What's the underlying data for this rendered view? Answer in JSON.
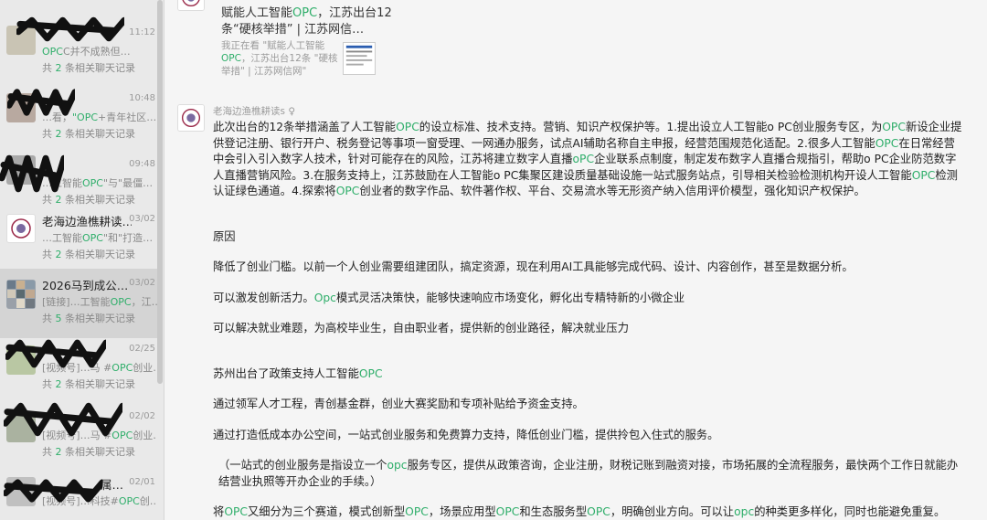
{
  "sidebar": {
    "items": [
      {
        "time": "11:12",
        "preview_pre": "",
        "preview_hl": "OPC",
        "preview_post": "C并不成熟但…",
        "rel_pre": "共 ",
        "rel_count": "2",
        "rel_post": " 条相关聊天记录"
      },
      {
        "time": "10:48",
        "preview_pre": "…看，",
        "preview_hl": "\"OPC",
        "preview_post": "+青年社区…",
        "rel_pre": "共 ",
        "rel_count": "2",
        "rel_post": " 条相关聊天记录"
      },
      {
        "time": "09:48",
        "preview_pre": "…工智能",
        "preview_hl": "OPC",
        "preview_post": "\"与\"最僵…",
        "rel_pre": "共 ",
        "rel_count": "2",
        "rel_post": " 条相关聊天记录"
      },
      {
        "name": "老海边渔樵耕读…",
        "time": "03/02",
        "preview_pre": "…工智能",
        "preview_hl": "OPC",
        "preview_post": "\"和\"打造…",
        "rel_pre": "共 ",
        "rel_count": "2",
        "rel_post": " 条相关聊天记录"
      },
      {
        "name": "2026马到成公…",
        "time": "03/02",
        "preview_pre": "[链接]…工智能",
        "preview_hl": "OPC",
        "preview_post": "，江…",
        "rel_pre": "共 ",
        "rel_count": "5",
        "rel_post": " 条相关聊天记录"
      },
      {
        "time": "02/25",
        "preview_pre": "[视频号]…马 #",
        "preview_hl": "OPC",
        "preview_post": "创业…",
        "rel_pre": "共 ",
        "rel_count": "2",
        "rel_post": " 条相关聊天记录"
      },
      {
        "time": "02/02",
        "preview_pre": "[视频号]…马 #",
        "preview_hl": "OPC",
        "preview_post": "创业…",
        "rel_pre": "共 ",
        "rel_count": "2",
        "rel_post": " 条相关聊天记录"
      },
      {
        "name_tail": "属…",
        "time": "02/01",
        "preview_pre": "[视频号]…科技#",
        "preview_hl": "OPC",
        "preview_post": "创…"
      }
    ]
  },
  "link_card": {
    "title_1": "赋能人工智能",
    "title_hl": "OPC",
    "title_2": "，江苏出台12条“硬核举措” | 江苏网信…",
    "desc_1": "我正在看 \"赋能人工智能",
    "desc_hl": "OPC",
    "desc_2": "，江苏出台12条 \"硬核举措\" | 江苏网信网\""
  },
  "message": {
    "sender": "老海边渔樵耕读s",
    "sender_suffix": "♀",
    "p1": [
      {
        "t": "此次出台的12条举措涵盖了人工智能"
      },
      {
        "h": "OPC"
      },
      {
        "t": "的设立标准、技术支持。营销、知识产权保护等。1.提出设立人工智能o PC创业服务专区，为"
      },
      {
        "h": "OPC"
      },
      {
        "t": "新设企业提供登记注册、银行开户、税务登记等事项一窗受理、一网通办服务，试点AI辅助名称自主申报，经营范围规范化适配。2.很多人工智能"
      },
      {
        "h": "OPC"
      },
      {
        "t": "在日常经营中会引入引入数字人技术，针对可能存在的风险，江苏将建立数字人直播"
      },
      {
        "h": "oPC"
      },
      {
        "t": "企业联系点制度，制定发布数字人直播合规指引，帮助o PC企业防范数字人直播营销风险。3.在服务支持上，江苏鼓励在人工智能o PC集聚区建设质量基础设施一站式服务站点，引导相关检验检测机构开设人工智能"
      },
      {
        "h": "OPC"
      },
      {
        "t": "检测认证绿色通道。4.探索将"
      },
      {
        "h": "OPC"
      },
      {
        "t": "创业者的数字作品、软件著作权、平台、交易流水等无形资产纳入信用评价模型，强化知识产权保护。"
      }
    ],
    "reason_title": "原因",
    "reason_1": "降低了创业门槛。以前一个人创业需要组建团队，搞定资源，现在利用AI工具能够完成代码、设计、内容创作，甚至是数据分析。",
    "reason_2": [
      {
        "h": "Opc"
      },
      {
        "t": "模式灵活决策快，能够快速响应市场变化，孵化出专精特新的小微企业"
      }
    ],
    "reason_2_pre": "可以激发创新活力。",
    "reason_3": "可以解决就业难题，为高校毕业生，自由职业者，提供新的创业路径，解决就业压力",
    "suzhou": [
      {
        "t": "苏州出台了政策支持人工智能"
      },
      {
        "h": "OPC"
      }
    ],
    "s1": "通过领军人才工程，青创基金群，创业大赛奖励和专项补贴给予资金支持。",
    "s2": "通过打造低成本办公空间，一站式创业服务和免费算力支持，降低创业门槛，提供拎包入住式的服务。",
    "s3": [
      {
        "t": "（一站式的创业服务是指设立一个"
      },
      {
        "h": "opc"
      },
      {
        "t": "服务专区，提供从政策咨询，企业注册，财税记账到融资对接，市场拓展的全流程服务，最快两个工作日就能办结营业执照等开办企业的手续。）"
      }
    ],
    "s4": [
      {
        "t": "将"
      },
      {
        "h": "OPC"
      },
      {
        "t": "又细分为三个赛道，模式创新型"
      },
      {
        "h": "OPC"
      },
      {
        "t": "，场景应用型"
      },
      {
        "h": "OPC"
      },
      {
        "t": "和生态服务型"
      },
      {
        "h": "OPC"
      },
      {
        "t": "，明确创业方向。可以让"
      },
      {
        "h": "opc"
      },
      {
        "t": "的种类更多样化，同时也能避免重复。"
      }
    ]
  }
}
